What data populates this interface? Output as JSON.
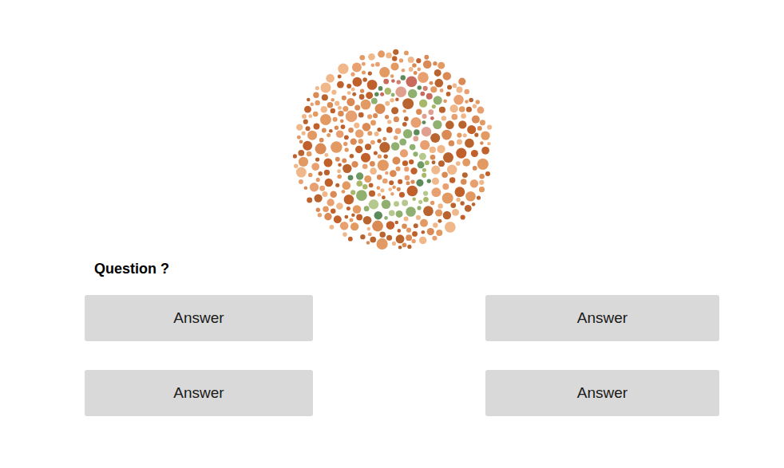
{
  "question": "Question ?",
  "answers": [
    {
      "label": "Answer"
    },
    {
      "label": "Answer"
    },
    {
      "label": "Answer"
    },
    {
      "label": "Answer"
    }
  ]
}
